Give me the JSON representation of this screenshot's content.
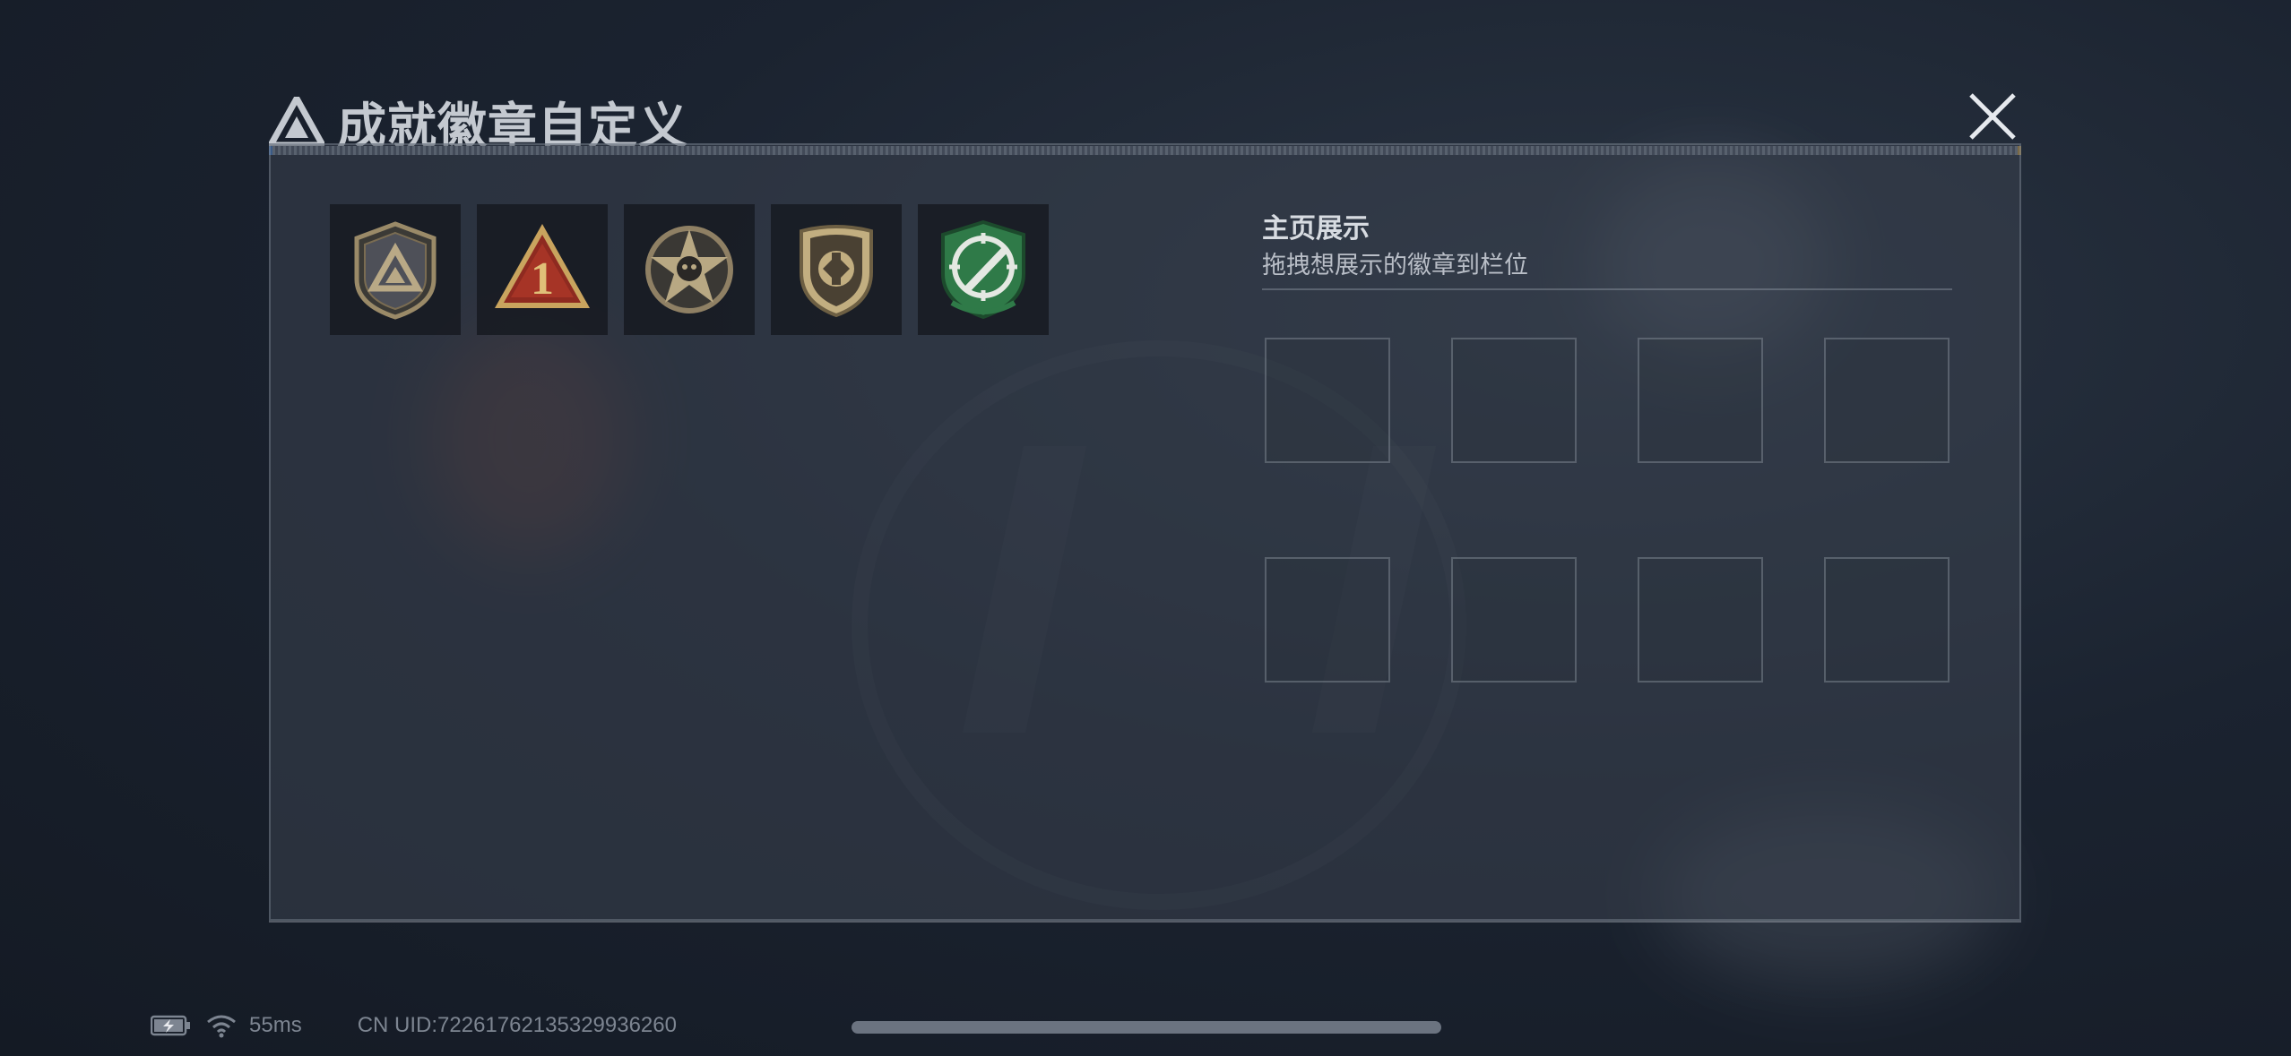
{
  "header": {
    "title": "成就徽章自定义",
    "logo_icon": "triangle-logo-icon",
    "close_icon": "close-icon"
  },
  "badges": [
    {
      "name": "tactical-triangle-badge",
      "colors": [
        "#8c7b60",
        "#5f6470"
      ]
    },
    {
      "name": "rank-one-badge",
      "colors": [
        "#a32d22",
        "#d9b36a"
      ]
    },
    {
      "name": "star-skull-badge",
      "colors": [
        "#8a7c60",
        "#2c2b2a"
      ]
    },
    {
      "name": "shield-emblem-badge",
      "colors": [
        "#b8a57a",
        "#3a3326"
      ]
    },
    {
      "name": "crosshair-knife-badge",
      "colors": [
        "#2e7a4a",
        "#e0e4e0"
      ]
    }
  ],
  "showcase": {
    "title": "主页展示",
    "subtitle": "拖拽想展示的徽章到栏位",
    "slot_count": 8
  },
  "status": {
    "battery_icon": "battery-charging-icon",
    "wifi_icon": "wifi-icon",
    "ping": "55ms",
    "uid": "CN UID:7226176213532993626​0"
  },
  "colors": {
    "accent_blue": "#3c78c7",
    "accent_gold": "#c79a3c",
    "panel": "#3a424e"
  }
}
